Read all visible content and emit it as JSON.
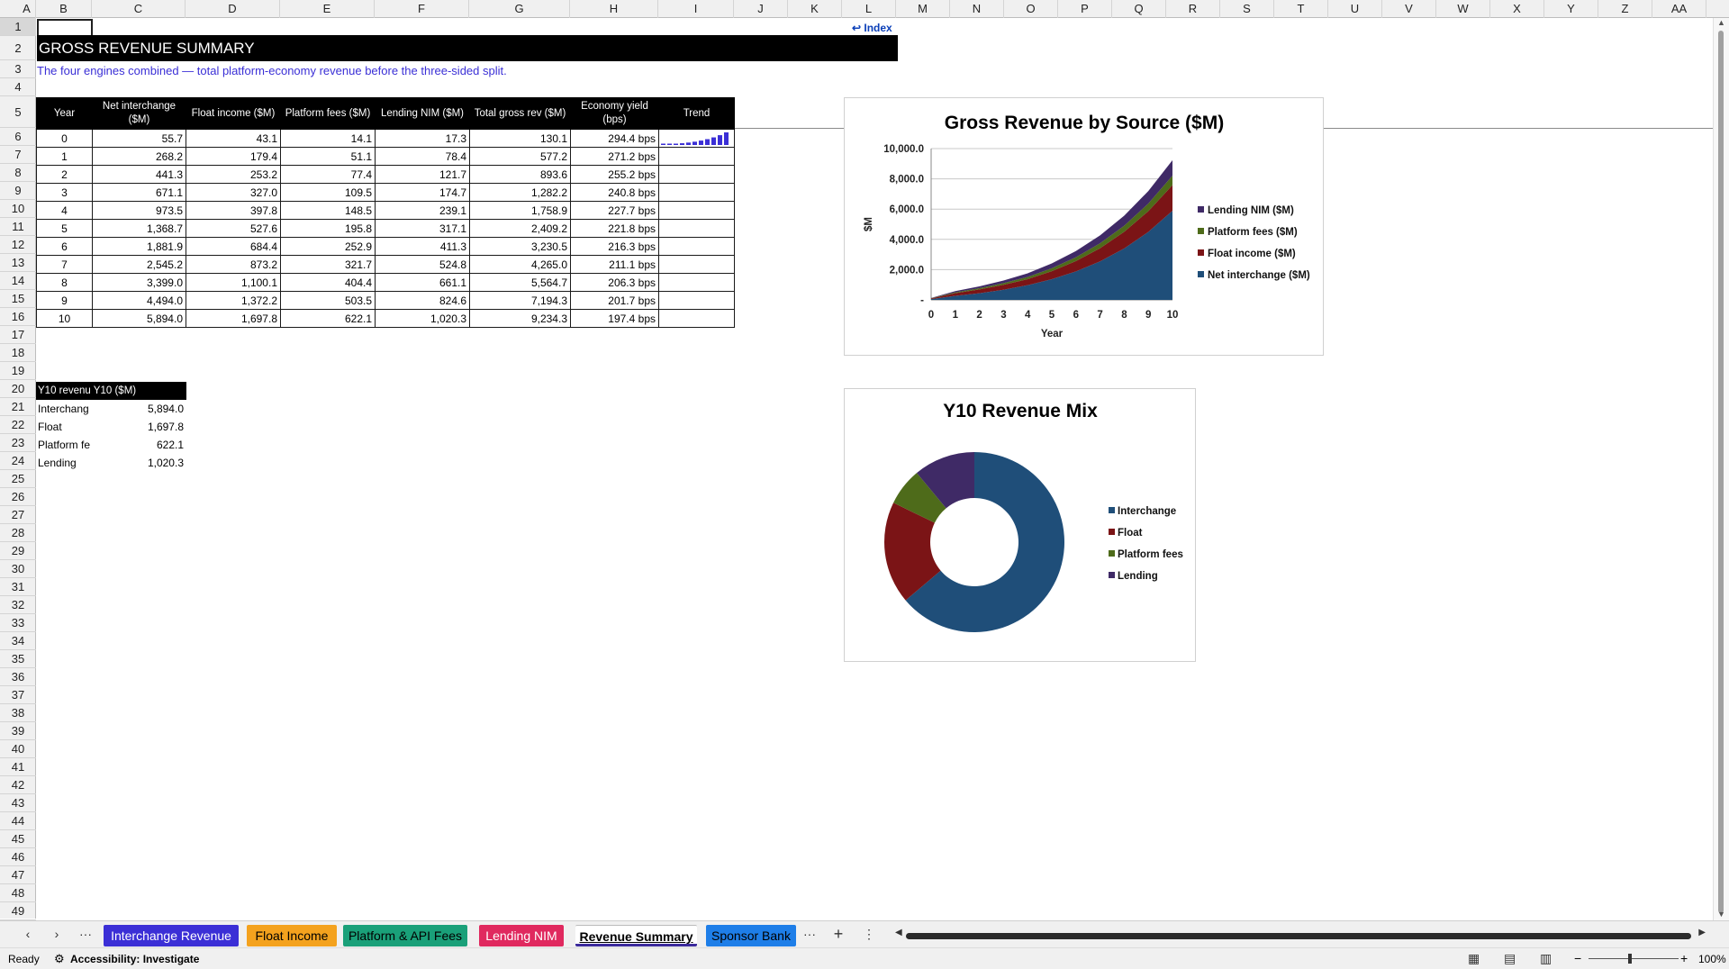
{
  "columns": [
    "A",
    "B",
    "C",
    "D",
    "E",
    "F",
    "G",
    "H",
    "I",
    "J",
    "K",
    "L",
    "M",
    "N",
    "O",
    "P",
    "Q",
    "R",
    "S",
    "T",
    "U",
    "V",
    "W",
    "X",
    "Y",
    "Z",
    "AA"
  ],
  "rows": [
    "1",
    "2",
    "3",
    "4",
    "5",
    "6",
    "7",
    "8",
    "9",
    "10",
    "11",
    "12",
    "13",
    "14",
    "15",
    "16",
    "17",
    "18",
    "19",
    "20",
    "21",
    "22",
    "23",
    "24",
    "25",
    "26",
    "27",
    "28",
    "29",
    "30",
    "31",
    "32",
    "33",
    "34",
    "35",
    "36",
    "37",
    "38",
    "39",
    "40",
    "41",
    "42",
    "43",
    "44",
    "45",
    "46",
    "47",
    "48",
    "49"
  ],
  "sheet": {
    "index_link": "↩ Index",
    "title": "GROSS REVENUE SUMMARY",
    "subtitle": "The four engines combined — total platform-economy revenue before the three-sided split.",
    "table": {
      "headers": [
        "Year",
        "Net interchange ($M)",
        "Float income ($M)",
        "Platform fees ($M)",
        "Lending NIM ($M)",
        "Total gross rev ($M)",
        "Economy yield (bps)",
        "Trend"
      ],
      "rows": [
        [
          "0",
          "55.7",
          "43.1",
          "14.1",
          "17.3",
          "130.1",
          "294.4 bps"
        ],
        [
          "1",
          "268.2",
          "179.4",
          "51.1",
          "78.4",
          "577.2",
          "271.2 bps"
        ],
        [
          "2",
          "441.3",
          "253.2",
          "77.4",
          "121.7",
          "893.6",
          "255.2 bps"
        ],
        [
          "3",
          "671.1",
          "327.0",
          "109.5",
          "174.7",
          "1,282.2",
          "240.8 bps"
        ],
        [
          "4",
          "973.5",
          "397.8",
          "148.5",
          "239.1",
          "1,758.9",
          "227.7 bps"
        ],
        [
          "5",
          "1,368.7",
          "527.6",
          "195.8",
          "317.1",
          "2,409.2",
          "221.8 bps"
        ],
        [
          "6",
          "1,881.9",
          "684.4",
          "252.9",
          "411.3",
          "3,230.5",
          "216.3 bps"
        ],
        [
          "7",
          "2,545.2",
          "873.2",
          "321.7",
          "524.8",
          "4,265.0",
          "211.1 bps"
        ],
        [
          "8",
          "3,399.0",
          "1,100.1",
          "404.4",
          "661.1",
          "5,564.7",
          "206.3 bps"
        ],
        [
          "9",
          "4,494.0",
          "1,372.2",
          "503.5",
          "824.6",
          "7,194.3",
          "201.7 bps"
        ],
        [
          "10",
          "5,894.0",
          "1,697.8",
          "622.1",
          "1,020.3",
          "9,234.3",
          "197.4 bps"
        ]
      ],
      "sparkline_values": [
        130.1,
        577.2,
        893.6,
        1282.2,
        1758.9,
        2409.2,
        3230.5,
        4265.0,
        5564.7,
        7194.3,
        9234.3
      ]
    },
    "mix_table": {
      "header": "Y10 revenu Y10 ($M)",
      "rows": [
        {
          "label": "Interchang",
          "value": "5,894.0"
        },
        {
          "label": "Float",
          "value": "1,697.8"
        },
        {
          "label": "Platform fe",
          "value": "622.1"
        },
        {
          "label": "Lending",
          "value": "1,020.3"
        }
      ]
    }
  },
  "chart_data": [
    {
      "type": "area",
      "stacked": true,
      "title": "Gross Revenue by Source ($M)",
      "xlabel": "Year",
      "ylabel": "$M",
      "x": [
        0,
        1,
        2,
        3,
        4,
        5,
        6,
        7,
        8,
        9,
        10
      ],
      "ylim": [
        0,
        10000
      ],
      "yticks": [
        "-",
        "2,000.0",
        "4,000.0",
        "6,000.0",
        "8,000.0",
        "10,000.0"
      ],
      "grid": true,
      "legend_position": "right",
      "series": [
        {
          "name": "Net interchange ($M)",
          "color": "#1f4e79",
          "values": [
            55.7,
            268.2,
            441.3,
            671.1,
            973.5,
            1368.7,
            1881.9,
            2545.2,
            3399.0,
            4494.0,
            5894.0
          ]
        },
        {
          "name": "Float income ($M)",
          "color": "#7b1416",
          "values": [
            43.1,
            179.4,
            253.2,
            327.0,
            397.8,
            527.6,
            684.4,
            873.2,
            1100.1,
            1372.2,
            1697.8
          ]
        },
        {
          "name": "Platform fees ($M)",
          "color": "#4e6b1a",
          "values": [
            14.1,
            51.1,
            77.4,
            109.5,
            148.5,
            195.8,
            252.9,
            321.7,
            404.4,
            503.5,
            622.1
          ]
        },
        {
          "name": "Lending NIM ($M)",
          "color": "#3f2a66",
          "values": [
            17.3,
            78.4,
            121.7,
            174.7,
            239.1,
            317.1,
            411.3,
            524.8,
            661.1,
            824.6,
            1020.3
          ]
        }
      ]
    },
    {
      "type": "pie",
      "donut": true,
      "title": "Y10 Revenue Mix",
      "legend_position": "right",
      "categories": [
        "Interchange",
        "Float",
        "Platform fees",
        "Lending"
      ],
      "values": [
        5894.0,
        1697.8,
        622.1,
        1020.3
      ],
      "colors": [
        "#1f4e79",
        "#7b1416",
        "#4e6b1a",
        "#3f2a66"
      ]
    }
  ],
  "tabs": [
    {
      "label": "Interchange Revenue",
      "color": "#3b2fd6",
      "text": "#ffffff"
    },
    {
      "label": "Float Income",
      "color": "#f4a21e",
      "text": "#000000"
    },
    {
      "label": "Platform & API Fees",
      "color": "#1aa079",
      "text": "#000000"
    },
    {
      "label": "Lending NIM",
      "color": "#e0295f",
      "text": "#ffffff"
    },
    {
      "label": "Revenue Summary",
      "color": "#ffffff",
      "text": "#000000",
      "active": true
    },
    {
      "label": "Sponsor Bank",
      "color": "#1e7ee8",
      "text": "#000000"
    }
  ],
  "status": {
    "ready": "Ready",
    "accessibility": "Accessibility: Investigate",
    "zoom": "100%"
  },
  "icons": {
    "nav_prev": "chevron-left-icon",
    "nav_next": "chevron-right-icon",
    "more": "ellipsis-icon",
    "add": "plus-icon",
    "options": "vertical-dots-icon"
  }
}
